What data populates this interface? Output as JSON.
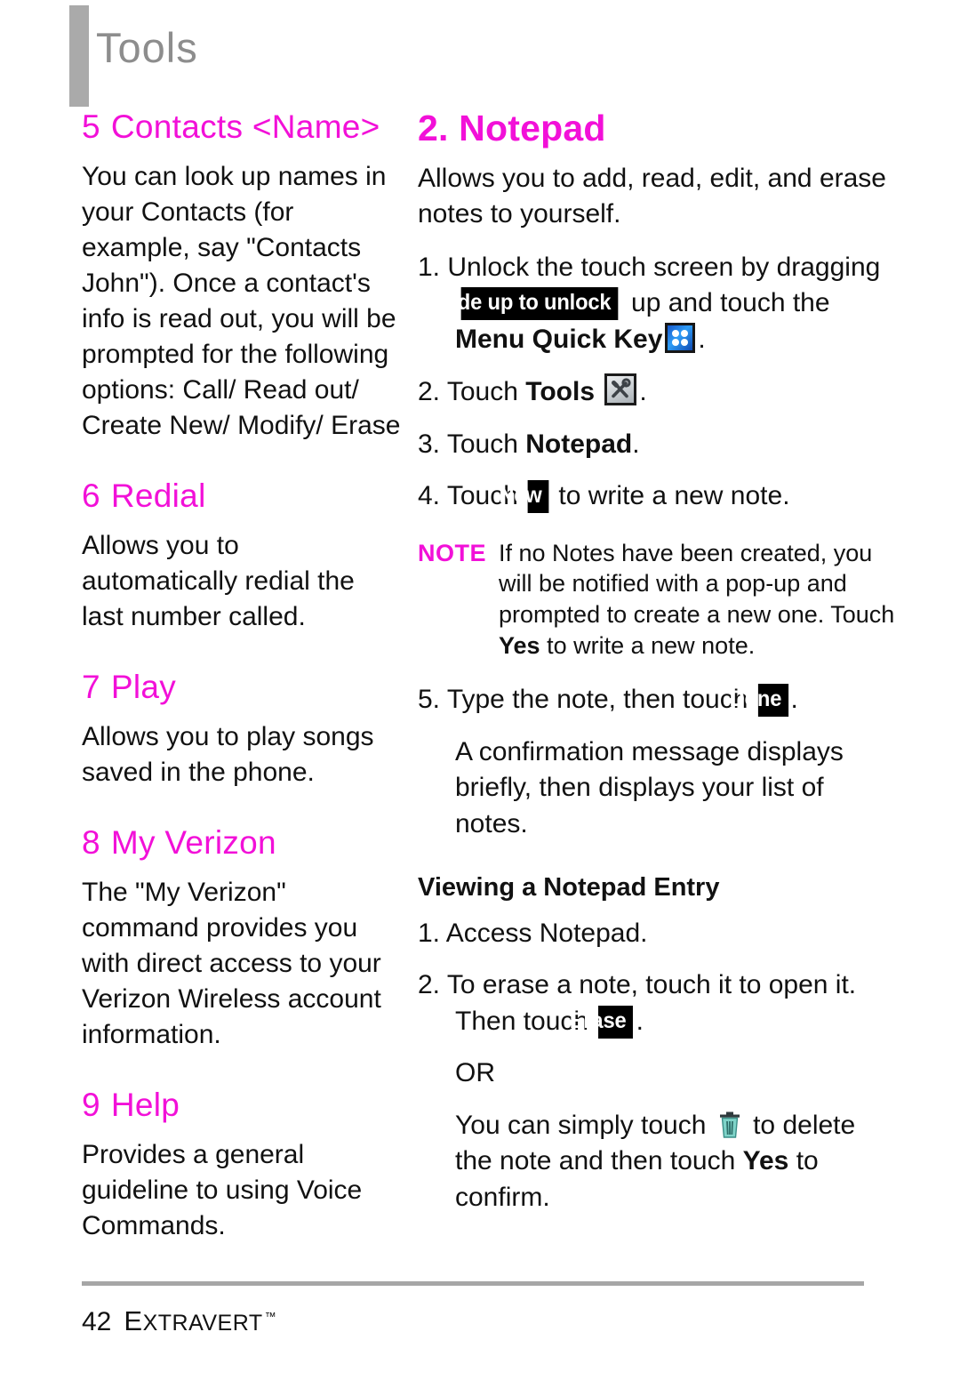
{
  "header": {
    "title": "Tools"
  },
  "left_column": {
    "sections": [
      {
        "num": "5",
        "title": "Contacts <Name>",
        "body": "You can look up names in your Contacts (for example, say \"Contacts John\"). Once a contact's info is read out, you will be prompted for the following options: Call/ Read out/ Create New/ Modify/ Erase"
      },
      {
        "num": "6",
        "title": "Redial",
        "body": "Allows you to automatically redial the last number called."
      },
      {
        "num": "7",
        "title": "Play",
        "body": "Allows you to play songs saved in the phone."
      },
      {
        "num": "8",
        "title": "My Verizon",
        "body": "The \"My Verizon\" command provides you with direct access to your Verizon Wireless account information."
      },
      {
        "num": "9",
        "title": "Help",
        "body": "Provides a general guideline to using Voice Commands."
      }
    ]
  },
  "right_column": {
    "heading": "2. Notepad",
    "intro": "Allows you to add, read, edit, and erase notes to yourself.",
    "steps": {
      "s1_num": "1.",
      "s1_a": "Unlock the touch screen by dragging",
      "s1_badge": "Slide up to unlock",
      "s1_b": "up and touch the",
      "s1_bold": "Menu Quick Key",
      "s1_c": ".",
      "s2_num": "2.",
      "s2_a": "Touch",
      "s2_bold": "Tools",
      "s2_b": ".",
      "s3_num": "3.",
      "s3_a": "Touch",
      "s3_bold": "Notepad",
      "s3_b": ".",
      "s4_num": "4.",
      "s4_a": "Touch",
      "s4_badge": "New",
      "s4_b": "to write a new note.",
      "s5_num": "5.",
      "s5_a": "Type the note, then touch",
      "s5_badge": "Done",
      "s5_b": ".",
      "s5_sub": "A confirmation message displays briefly, then displays your list of notes."
    },
    "note": {
      "label": "NOTE",
      "text_a": "If no Notes have been created, you will be notified with a pop-up and prompted to create a new one. Touch",
      "text_bold": "Yes",
      "text_b": "to write a new note."
    },
    "subsection": {
      "heading": "Viewing a Notepad Entry",
      "v1_num": "1.",
      "v1_text": "Access Notepad.",
      "v2_num": "2.",
      "v2_a": "To erase a note, touch it to open it. Then touch",
      "v2_badge": "Erase",
      "v2_b": ".",
      "or": "OR",
      "v3_a": "You can simply touch",
      "v3_b": "to delete the note and then touch",
      "v3_bold": "Yes",
      "v3_c": "to confirm."
    }
  },
  "icons": {
    "menu_quick_key": "menu-quick-key-icon",
    "tools": "tools-icon",
    "trash": "trash-icon"
  },
  "footer": {
    "page_number": "42",
    "brand_first": "E",
    "brand_rest": "XTRAVERT",
    "trademark": "™"
  },
  "colors": {
    "accent_magenta": "#f210d8",
    "header_gray": "#8d8d8d",
    "bar_gray": "#aaaaaa",
    "badge_bg": "#000000"
  }
}
